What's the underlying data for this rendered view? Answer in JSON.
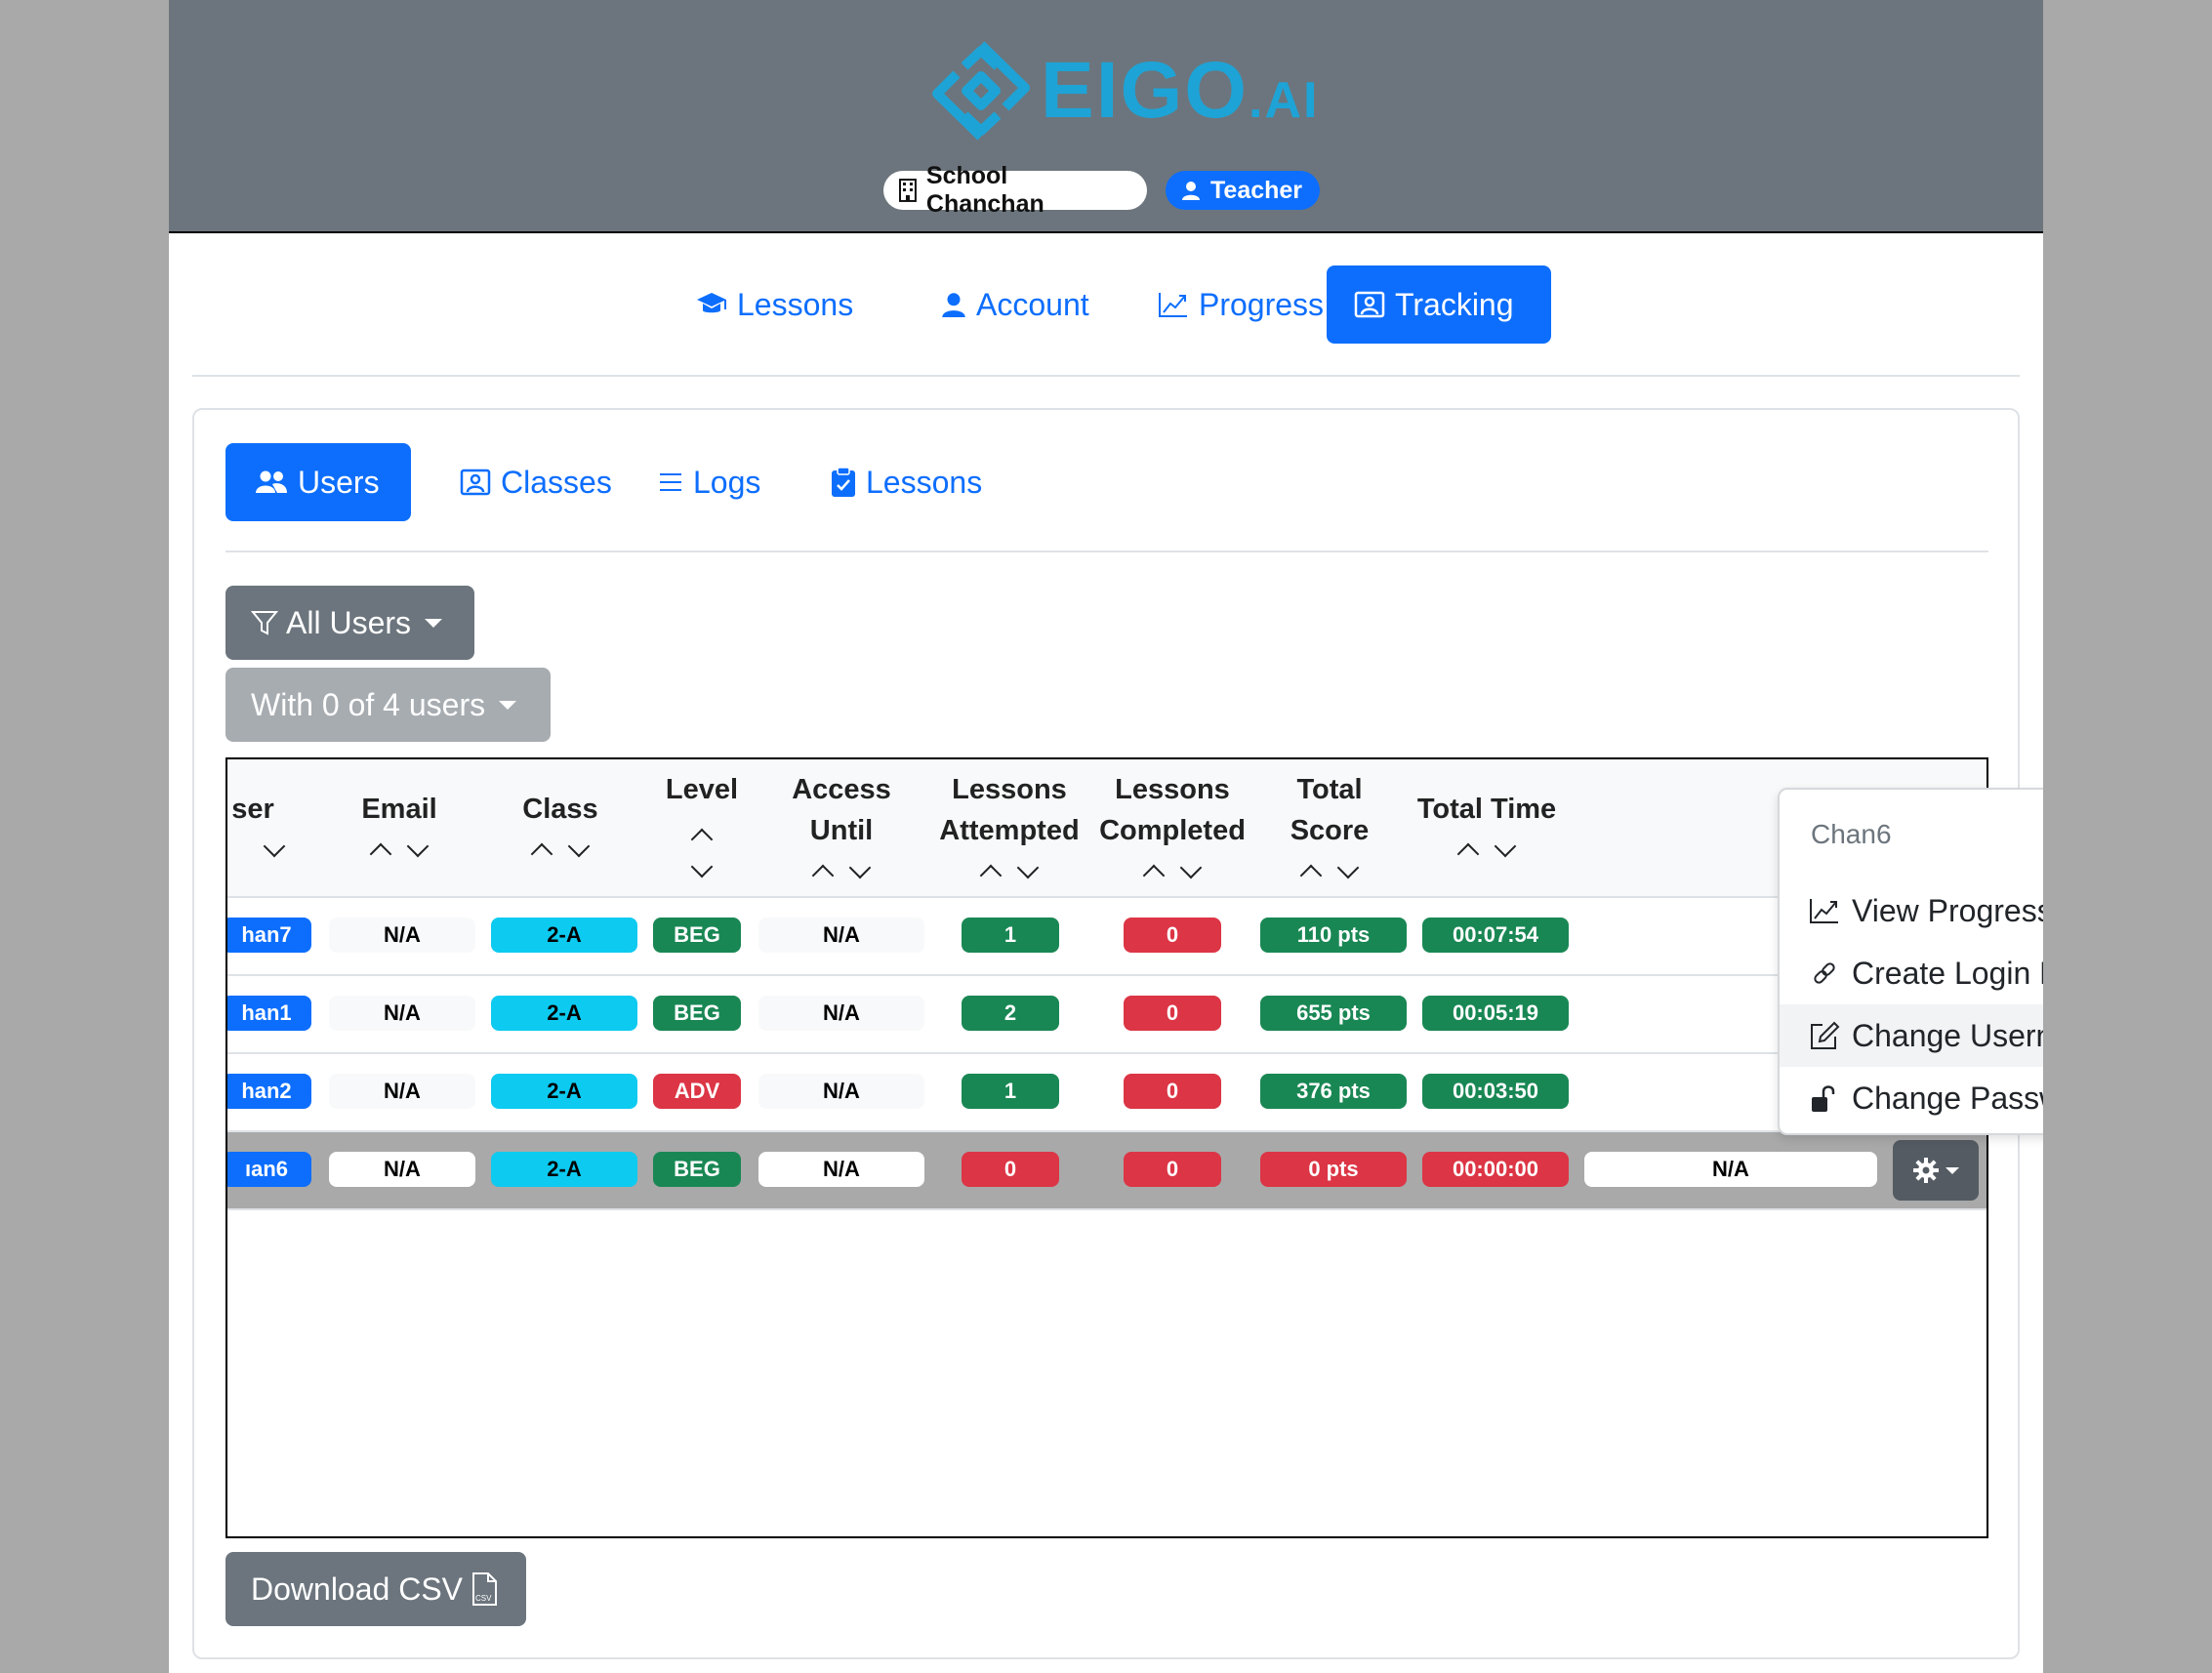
{
  "header": {
    "logo_text": "EIGO",
    "logo_suffix": ".AI",
    "school_name": "School Chanchan",
    "role": "Teacher",
    "brand_color": "#1ea3d6"
  },
  "main_nav": [
    {
      "label": "Lessons",
      "icon": "graduation-cap-icon"
    },
    {
      "label": "Account",
      "icon": "person-icon"
    },
    {
      "label": "Progress",
      "icon": "graph-up-icon"
    },
    {
      "label": "Tracking",
      "icon": "person-video-icon",
      "active": true
    }
  ],
  "sub_nav": [
    {
      "label": "Users",
      "icon": "people-icon",
      "active": true
    },
    {
      "label": "Classes",
      "icon": "person-video-icon"
    },
    {
      "label": "Logs",
      "icon": "list-icon"
    },
    {
      "label": "Lessons",
      "icon": "clipboard-check-icon"
    }
  ],
  "filter": {
    "label": "All Users"
  },
  "selection": {
    "label": "With 0 of 4 users"
  },
  "table": {
    "columns": [
      {
        "line1": "ser",
        "line2": ""
      },
      {
        "line1": "Email",
        "line2": ""
      },
      {
        "line1": "Class",
        "line2": ""
      },
      {
        "line1": "Level",
        "line2": ""
      },
      {
        "line1": "Access",
        "line2": "Until"
      },
      {
        "line1": "Lessons",
        "line2": "Attempted"
      },
      {
        "line1": "Lessons",
        "line2": "Completed"
      },
      {
        "line1": "Total",
        "line2": "Score"
      },
      {
        "line1": "Total Time",
        "line2": ""
      }
    ],
    "rows": [
      {
        "user": "han7",
        "email": "N/A",
        "class": "2-A",
        "level": "BEG",
        "access": "N/A",
        "attempted": "1",
        "completed": "0",
        "score": "110 pts",
        "time": "00:07:54"
      },
      {
        "user": "han1",
        "email": "N/A",
        "class": "2-A",
        "level": "BEG",
        "access": "N/A",
        "attempted": "2",
        "completed": "0",
        "score": "655 pts",
        "time": "00:05:19"
      },
      {
        "user": "han2",
        "email": "N/A",
        "class": "2-A",
        "level": "ADV",
        "access": "N/A",
        "attempted": "1",
        "completed": "0",
        "score": "376 pts",
        "time": "00:03:50"
      },
      {
        "user": "ıan6",
        "email": "N/A",
        "class": "2-A",
        "level": "BEG",
        "access": "N/A",
        "attempted": "0",
        "completed": "0",
        "score": "0 pts",
        "time": "00:00:00",
        "extra": "N/A",
        "selected": true
      }
    ]
  },
  "menu": {
    "header": "Chan6",
    "items": [
      {
        "label": "View Progress",
        "icon": "graph-up-icon"
      },
      {
        "label": "Create Login Link",
        "icon": "link-icon"
      },
      {
        "label": "Change Username",
        "icon": "pencil-square-icon"
      },
      {
        "label": "Change Password",
        "icon": "unlock-icon"
      }
    ]
  },
  "download": {
    "label": "Download CSV",
    "icon": "csv-file-icon"
  }
}
